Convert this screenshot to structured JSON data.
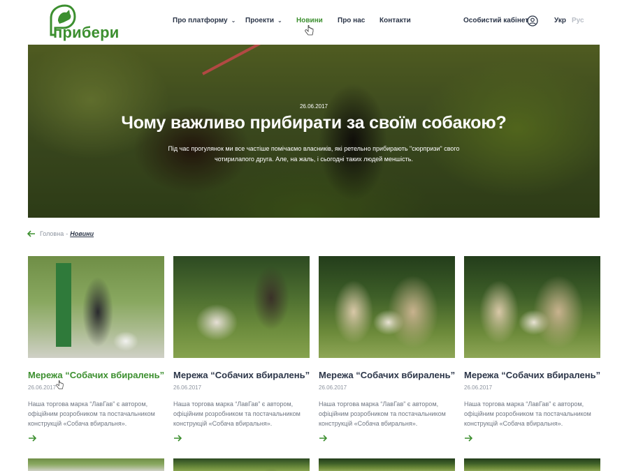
{
  "header": {
    "logo_text": "прибери",
    "nav": [
      {
        "label": "Про платформу",
        "has_dropdown": true,
        "active": false
      },
      {
        "label": "Проекти",
        "has_dropdown": true,
        "active": false
      },
      {
        "label": "Новини",
        "has_dropdown": false,
        "active": true
      },
      {
        "label": "Про нас",
        "has_dropdown": false,
        "active": false
      },
      {
        "label": "Контакти",
        "has_dropdown": false,
        "active": false
      }
    ],
    "cabinet_label": "Особистий кабінет",
    "lang_ukr": "Укр",
    "lang_rus": "Рус"
  },
  "hero": {
    "date": "26.06.2017",
    "title": "Чому важливо прибирати за своїм собакою?",
    "description": "Під час прогулянок ми все частіше помічаємо власників, які ретельно прибирають \"сюрпризи\" свого чотирилапого друга. Але, на жаль, і сьогодні таких людей меншість."
  },
  "breadcrumb": {
    "home": "Головна",
    "separator": "-",
    "current": "Новини"
  },
  "cards": [
    {
      "title": "Мережа “Собачих вбиралень”",
      "date": "26.06.2017",
      "text": "Наша торгова марка “ЛавГав” є автором, офіційним розробником та постачальником конструкцій «Собача вбиральня».",
      "image": "dog-park-photo",
      "hovered": true
    },
    {
      "title": "Мережа “Собачих вбиралень”",
      "date": "26.06.2017",
      "text": "Наша торгова марка “ЛавГав” є автором, офіційним розробником та постачальником конструкцій «Собача вбиральня».",
      "image": "man-with-bulldog-photo",
      "hovered": false
    },
    {
      "title": "Мережа “Собачих вбиралень”",
      "date": "26.06.2017",
      "text": "Наша торгова марка “ЛавГав” є автором, офіційним розробником та постачальником конструкцій «Собача вбиральня».",
      "image": "girls-with-puppy-photo",
      "hovered": false
    },
    {
      "title": "Мережа “Собачих вбиралень”",
      "date": "26.06.2017",
      "text": "Наша торгова марка “ЛавГав” є автором, офіційним розробником та постачальником конструкцій «Собача вбиральня».",
      "image": "girls-with-puppy-photo",
      "hovered": false
    }
  ],
  "colors": {
    "brand_green": "#3c8f2f",
    "text_dark": "#2b3548",
    "text_muted": "#8d949f"
  }
}
